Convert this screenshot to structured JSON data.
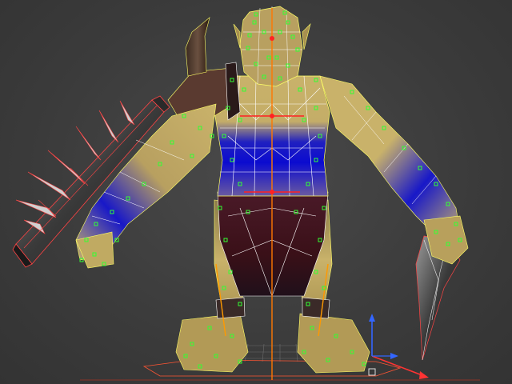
{
  "viewport": {
    "background_color": "#3d3d3d",
    "wireframe_color": "#ffffff",
    "selected_wire_color": "#ffff33",
    "vertex_color": "#33ff33",
    "bone_color": "#ff6600",
    "weapon_edge_color": "#ff4444"
  },
  "materials": {
    "skin_color": "#c9b26a",
    "shadow_skin_color": "#5a4a2a",
    "weight_blue": "#0b0bd0",
    "loincloth_color": "#3a1018",
    "shoulder_pad_color": "#5a3a30",
    "spike_color": "#d8d8d8",
    "metal_color": "#6a6a6a"
  },
  "gizmo": {
    "x_axis_color": "#ff2a2a",
    "y_axis_color": "#2a6bff",
    "z_axis_color": "#3366ff",
    "icon": "transform-gizmo-icon"
  },
  "grid": {
    "line_color": "#888888",
    "icon": "ground-grid-icon"
  }
}
